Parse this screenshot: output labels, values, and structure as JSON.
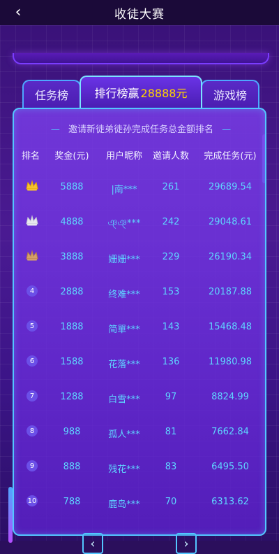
{
  "header": {
    "title": "收徒大赛"
  },
  "tabs": [
    {
      "label": "任务榜"
    },
    {
      "label": "排行榜赢",
      "prize": "28888元"
    },
    {
      "label": "游戏榜"
    }
  ],
  "panel": {
    "subtitle": "邀请新徒弟徒孙完成任务总金额排名",
    "columns": [
      "排名",
      "奖金(元)",
      "用户昵称",
      "邀请人数",
      "完成任务(元)"
    ]
  },
  "rows": [
    {
      "rank": "1",
      "bonus": "5888",
      "name": "|南***",
      "invites": "261",
      "tasks": "29689.54"
    },
    {
      "rank": "2",
      "bonus": "4888",
      "name": "ঞ্ঞ্***",
      "invites": "242",
      "tasks": "29048.61"
    },
    {
      "rank": "3",
      "bonus": "3888",
      "name": "姗姗***",
      "invites": "229",
      "tasks": "26190.34"
    },
    {
      "rank": "4",
      "bonus": "2888",
      "name": "终难***",
      "invites": "153",
      "tasks": "20187.88"
    },
    {
      "rank": "5",
      "bonus": "1888",
      "name": "简單***",
      "invites": "143",
      "tasks": "15468.48"
    },
    {
      "rank": "6",
      "bonus": "1588",
      "name": "花落***",
      "invites": "136",
      "tasks": "11980.98"
    },
    {
      "rank": "7",
      "bonus": "1288",
      "name": "白雪***",
      "invites": "97",
      "tasks": "8824.99"
    },
    {
      "rank": "8",
      "bonus": "988",
      "name": "孤人***",
      "invites": "81",
      "tasks": "7662.84"
    },
    {
      "rank": "9",
      "bonus": "888",
      "name": "残花***",
      "invites": "83",
      "tasks": "6495.50"
    },
    {
      "rank": "10",
      "bonus": "788",
      "name": "鹿岛***",
      "invites": "70",
      "tasks": "6313.62"
    }
  ],
  "pager": {
    "prev_icon": "chevron-left-icon",
    "next_icon": "chevron-right-icon"
  }
}
